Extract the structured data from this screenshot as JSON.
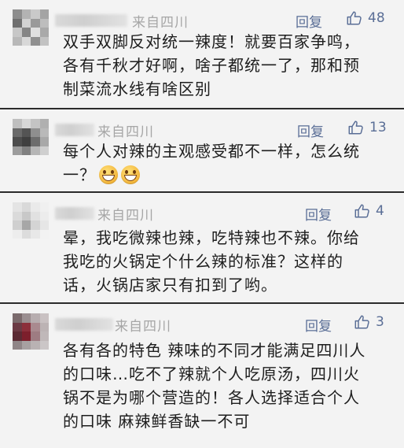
{
  "comments": [
    {
      "source": "来自四川",
      "reply_label": "回复",
      "likes": "48",
      "lines": [
        "双手双脚反对统一辣度！就要百家争鸣，",
        "各有千秋才好啊，啥子都统一了，那和预",
        "制菜流水线有啥区别"
      ],
      "avatar_colors": [
        "#8d8d8d",
        "#b3b3b3",
        "#c9c9c9",
        "#a4a4a4",
        "#6f6f6f",
        "#d2d2d2",
        "#9a9a9a",
        "#bdbdbd",
        "#c7c7c7",
        "#858585",
        "#e0e0e0",
        "#a9a9a9",
        "#b8b8b8",
        "#d8d8d8",
        "#909090",
        "#c2c2c2"
      ]
    },
    {
      "source": "来自四川",
      "reply_label": "回复",
      "likes": "13",
      "lines": [
        "每个人对辣的主观感受都不一样，怎么统",
        "一？"
      ],
      "emoji": [
        "grin-emoji",
        "grin-emoji"
      ],
      "avatar_colors": [
        "#bfbfbf",
        "#d7d7d7",
        "#c4c4c4",
        "#b0b0b0",
        "#6a6a6a",
        "#545454",
        "#8f8f8f",
        "#b9b9b9",
        "#4d4d4d",
        "#3f3f3f",
        "#6d6d6d",
        "#a8a8a8",
        "#9c9c9c",
        "#808080",
        "#b6b6b6",
        "#cfcfcf"
      ]
    },
    {
      "source": "来自四川",
      "reply_label": "回复",
      "likes": "4",
      "lines": [
        "晕，我吃微辣也辣，吃特辣也不辣。你给",
        "我吃的火锅定个什么辣的标准？这样的",
        "话，火锅店家只有扣到了哟。"
      ],
      "avatar_colors": [
        "#e4e4e4",
        "#d9d9d9",
        "#eaeaea",
        "#f0f0f0",
        "#dadada",
        "#c8c8c8",
        "#e1e1e1",
        "#ececec",
        "#cfcfcf",
        "#a7a7a7",
        "#d4d4d4",
        "#e6e6e6",
        "#ededed",
        "#dcdcdc",
        "#e8e8e8",
        "#f2f2f2"
      ]
    },
    {
      "source": "来自四川",
      "reply_label": "回复",
      "likes": "3",
      "lines": [
        "各有各的特色 辣味的不同才能满足四川人",
        "的口味…吃不了辣就个人吃原汤，四川火",
        "锅不是为哪个营造的！各人选择适合个人",
        "的口味 麻辣鲜香缺一不可"
      ],
      "avatar_colors": [
        "#7a6a6c",
        "#9a8e90",
        "#b7adaf",
        "#c9c1c2",
        "#6b3a44",
        "#8c2f3b",
        "#a98a8f",
        "#bcb3b4",
        "#5b2a33",
        "#7d1f2c",
        "#9e7c82",
        "#c0b8b9",
        "#8f8587",
        "#a7a0a1",
        "#b9b2b3",
        "#cbc6c7"
      ]
    }
  ]
}
